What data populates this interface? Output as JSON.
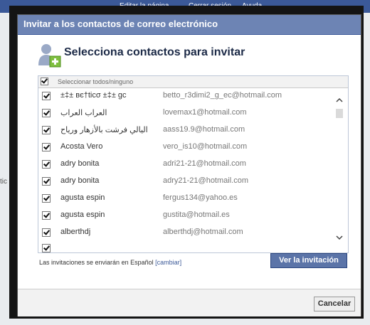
{
  "background": {
    "partial_texts": [
      "Editar la página",
      "Cerrar sesión",
      "Ayuda",
      "tic"
    ]
  },
  "dialog": {
    "title": "Invitar a los contactos de correo electrónico",
    "heading": "Selecciona contactos para invitar",
    "select_all_label": "Seleccionar todos/ninguno",
    "contacts": [
      {
        "name": "±‡± вє†ticσ ±‡± gc",
        "email": "betto_r3dimi2_g_ec@hotmail.com",
        "checked": true
      },
      {
        "name": "العراب العراب",
        "email": "lovemax1@hotmail.com",
        "checked": true
      },
      {
        "name": "اليالي فرشت بالأزهار ورياح",
        "email": "aass19.9@hotmail.com",
        "checked": true
      },
      {
        "name": "Acosta Vero",
        "email": "vero_is10@hotmail.com",
        "checked": true
      },
      {
        "name": "adry bonita",
        "email": "adri21-21@hotmail.com",
        "checked": true
      },
      {
        "name": "adry bonita",
        "email": "adry21-21@hotmail.com",
        "checked": true
      },
      {
        "name": "agusta espin",
        "email": "fergus134@yahoo.es",
        "checked": true
      },
      {
        "name": "agusta espin",
        "email": "gustita@hotmail.es",
        "checked": true
      },
      {
        "name": "alberthdj",
        "email": "alberthdj@hotmail.com",
        "checked": true
      }
    ],
    "language_note": "Las invitaciones se enviarán en Español",
    "change_link": "[cambiar]",
    "view_invitation_button": "Ver la invitación",
    "cancel_button": "Cancelar"
  },
  "colors": {
    "title_bar": "#6d84b4",
    "primary_button": "#5b74a8",
    "link": "#3b5998"
  }
}
